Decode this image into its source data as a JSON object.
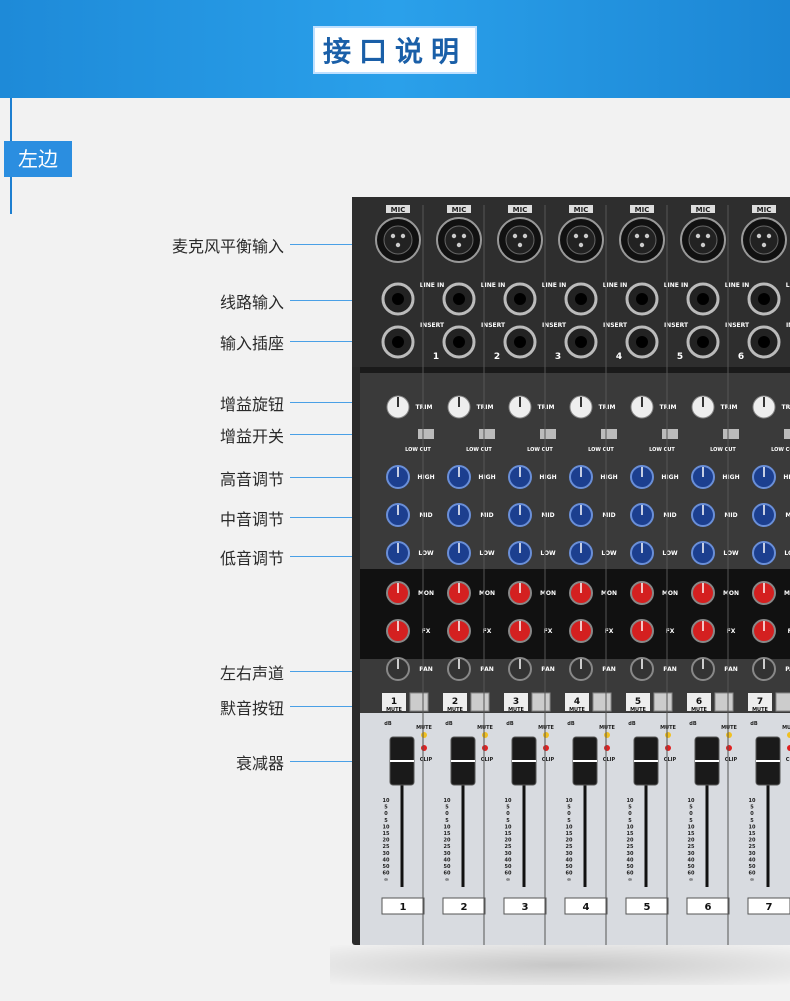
{
  "header": {
    "title": "接口说明"
  },
  "section_tag": "左边",
  "labels": [
    {
      "id": "mic-balanced-input",
      "text": "麦克风平衡输入"
    },
    {
      "id": "line-input",
      "text": "线路输入"
    },
    {
      "id": "insert-jack",
      "text": "输入插座"
    },
    {
      "id": "gain-knob",
      "text": "增益旋钮"
    },
    {
      "id": "gain-switch",
      "text": "增益开关"
    },
    {
      "id": "treble-eq",
      "text": "高音调节"
    },
    {
      "id": "mid-eq",
      "text": "中音调节"
    },
    {
      "id": "bass-eq",
      "text": "低音调节"
    },
    {
      "id": "pan",
      "text": "左右声道"
    },
    {
      "id": "mute-button",
      "text": "默音按钮"
    },
    {
      "id": "fader",
      "text": "衰减器"
    }
  ],
  "mixer": {
    "channels": [
      "1",
      "2",
      "3",
      "4",
      "5",
      "6",
      "7"
    ],
    "mic_label": "MIC",
    "line_in_label": "LINE IN",
    "insert_label": "INSERT",
    "trim_label": "TRIM",
    "low_cut_label": "LOW CUT",
    "high_label": "HIGH",
    "mid_label": "MID",
    "low_label": "LOW",
    "mon_label": "MON",
    "fx_label": "FX",
    "pan_label": "PAN",
    "mute_label": "MUTE",
    "clip_label": "CLIP",
    "db_label": "dB",
    "fader_scale": [
      "10",
      "5",
      "0",
      "5",
      "10",
      "15",
      "20",
      "25",
      "30",
      "40",
      "50",
      "60",
      "∞"
    ]
  }
}
